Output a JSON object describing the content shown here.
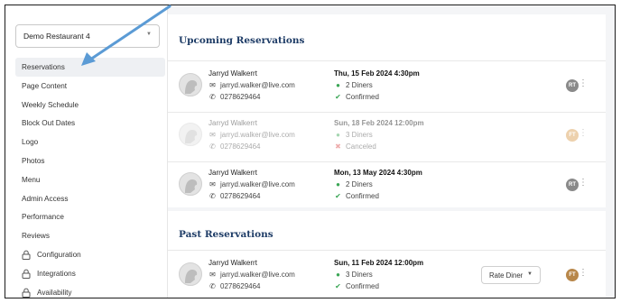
{
  "sidebar": {
    "restaurant_select": "Demo Restaurant 4",
    "items": [
      {
        "label": "Reservations",
        "active": true
      },
      {
        "label": "Page Content"
      },
      {
        "label": "Weekly Schedule"
      },
      {
        "label": "Block Out Dates"
      },
      {
        "label": "Logo"
      },
      {
        "label": "Photos"
      },
      {
        "label": "Menu"
      },
      {
        "label": "Admin Access"
      },
      {
        "label": "Performance"
      },
      {
        "label": "Reviews"
      },
      {
        "label": "Configuration",
        "locked": true
      },
      {
        "label": "Integrations",
        "locked": true
      },
      {
        "label": "Availability",
        "locked": true
      }
    ]
  },
  "upcoming": {
    "title": "Upcoming Reservations",
    "rows": [
      {
        "name": "Jarryd Walkerrt",
        "email": "jarryd.walker@live.com",
        "phone": "0278629464",
        "date": "Thu, 15 Feb 2024 4:30pm",
        "diners": "2 Diners",
        "status": "Confirmed",
        "badge": "RT",
        "badge_color": "#8a8a8a",
        "status_color": "#3aa655"
      },
      {
        "name": "Jarryd Walkerrt",
        "email": "jarryd.walker@live.com",
        "phone": "0278629464",
        "date": "Sun, 18 Feb 2024 12:00pm",
        "diners": "3 Diners",
        "status": "Canceled",
        "badge": "FT",
        "badge_color": "#d99a4b",
        "status_color": "#d94a4a"
      },
      {
        "name": "Jarryd Walkerrt",
        "email": "jarryd.walker@live.com",
        "phone": "0278629464",
        "date": "Mon, 13 May 2024 4:30pm",
        "diners": "2 Diners",
        "status": "Confirmed",
        "badge": "RT",
        "badge_color": "#8a8a8a",
        "status_color": "#3aa655"
      }
    ]
  },
  "past": {
    "title": "Past Reservations",
    "rows": [
      {
        "name": "Jarryd Walkerrt",
        "email": "jarryd.walker@live.com",
        "phone": "0278629464",
        "date": "Sun, 11 Feb 2024 12:00pm",
        "diners": "3 Diners",
        "status": "Confirmed",
        "badge": "FT",
        "badge_color": "#b8874a",
        "status_color": "#3aa655",
        "rate_label": "Rate Diner"
      }
    ]
  },
  "colors": {
    "accent_blue": "#1f3d67",
    "arrow": "#5b9bd5"
  }
}
